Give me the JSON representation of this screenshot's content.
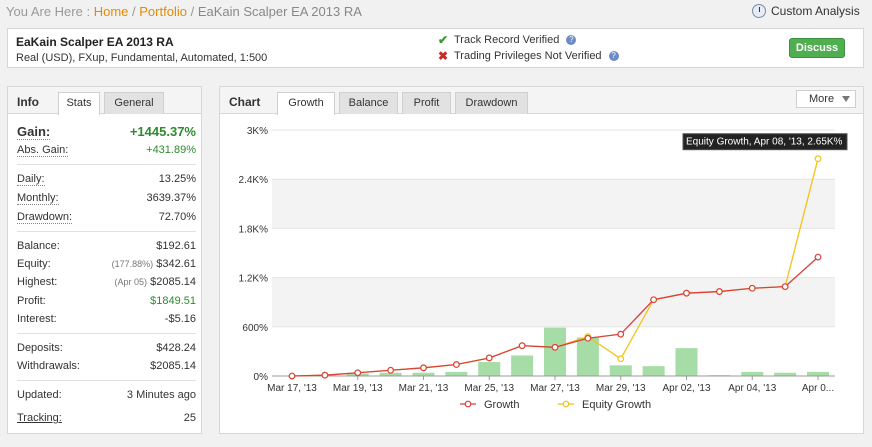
{
  "breadcrumb": {
    "prefix": "You Are Here :",
    "home": "Home",
    "sep": "/",
    "portfolio": "Portfolio",
    "current": "EaKain Scalper EA 2013 RA"
  },
  "custom_analysis": "Custom Analysis",
  "header": {
    "title": "EaKain Scalper EA 2013 RA",
    "subtitle": "Real (USD), FXup, Fundamental, Automated, 1:500",
    "track_record": "Track Record Verified",
    "trading_privileges": "Trading Privileges Not Verified",
    "question_mark": "?",
    "discuss": "Discuss"
  },
  "info": {
    "title": "Info",
    "tabs": [
      "Stats",
      "General"
    ],
    "gain": {
      "label": "Gain:",
      "value": "+1445.37%"
    },
    "abs_gain": {
      "label": "Abs. Gain:",
      "value": "+431.89%"
    },
    "daily": {
      "label": "Daily:",
      "value": "13.25%"
    },
    "monthly": {
      "label": "Monthly:",
      "value": "3639.37%"
    },
    "drawdown": {
      "label": "Drawdown:",
      "value": "72.70%"
    },
    "balance": {
      "label": "Balance:",
      "value": "$192.61"
    },
    "equity": {
      "label": "Equity:",
      "prefix": "(177.88%)",
      "value": "$342.61"
    },
    "highest": {
      "label": "Highest:",
      "prefix": "(Apr 05)",
      "value": "$2085.14"
    },
    "profit": {
      "label": "Profit:",
      "value": "$1849.51"
    },
    "interest": {
      "label": "Interest:",
      "value": "-$5.16"
    },
    "deposits": {
      "label": "Deposits:",
      "value": "$428.24"
    },
    "withdrawals": {
      "label": "Withdrawals:",
      "value": "$2085.14"
    },
    "updated": {
      "label": "Updated:",
      "value": "3 Minutes ago"
    },
    "tracking": {
      "label": "Tracking:",
      "value": "25"
    }
  },
  "chart_panel": {
    "title": "Chart",
    "tabs": [
      "Growth",
      "Balance",
      "Profit",
      "Drawdown"
    ],
    "more": "More",
    "tooltip": "Equity Growth, Apr 08, '13, 2.65K%"
  },
  "colors": {
    "growth": "#d9413b",
    "equity": "#f2c318",
    "bars": "#a6dca6",
    "accent": "#e68a00"
  },
  "chart_data": {
    "type": "line",
    "ylim": [
      0,
      3000
    ],
    "yticks": [
      0,
      600,
      1200,
      1800,
      2400,
      3000
    ],
    "ytick_labels": [
      "0%",
      "600%",
      "1.2K%",
      "1.8K%",
      "2.4K%",
      "3K%"
    ],
    "xtick_labels": [
      "Mar 17, '13",
      "Mar 19, '13",
      "Mar 21, '13",
      "Mar 25, '13",
      "Mar 27, '13",
      "Mar 29, '13",
      "Apr 02, '13",
      "Apr 04, '13",
      "Apr 0..."
    ],
    "xtick_index": [
      0,
      2,
      4,
      6,
      8,
      10,
      12,
      14,
      16
    ],
    "series": [
      {
        "name": "Growth",
        "values": [
          0,
          10,
          40,
          70,
          100,
          140,
          220,
          370,
          350,
          460,
          510,
          930,
          1010,
          1030,
          1070,
          1090,
          1450
        ]
      },
      {
        "name": "Equity Growth",
        "values": [
          0,
          10,
          40,
          70,
          100,
          140,
          220,
          370,
          350,
          480,
          210,
          930,
          1010,
          1030,
          1070,
          1090,
          2650
        ]
      }
    ],
    "bars": [
      0,
      10,
      30,
      40,
      40,
      50,
      170,
      250,
      590,
      470,
      130,
      120,
      340,
      10,
      50,
      40,
      50
    ]
  }
}
